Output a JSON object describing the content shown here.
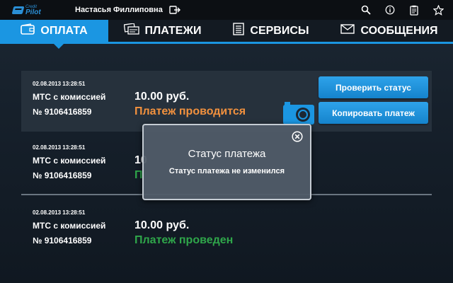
{
  "app": {
    "logo_line1": "Credit",
    "logo_line2": "Pilot",
    "brand_color": "#1b96e2"
  },
  "header": {
    "username": "Настасья Филлиповна",
    "icons": [
      "logout-icon",
      "search-icon",
      "info-icon",
      "clipboard-icon",
      "star-icon"
    ]
  },
  "nav": {
    "tabs": [
      {
        "label": "ОПЛАТА",
        "icon": "wallet-icon",
        "active": true
      },
      {
        "label": "ПЛАТЕЖИ",
        "icon": "payments-icon",
        "active": false
      },
      {
        "label": "СЕРВИСЫ",
        "icon": "list-icon",
        "active": false
      },
      {
        "label": "СООБЩЕНИЯ",
        "icon": "envelope-icon",
        "active": false
      }
    ]
  },
  "payments": [
    {
      "date": "02.08.2013 13:28:51",
      "name": "МТС с комиссией",
      "number": "№ 9106416859",
      "amount": "10.00 руб.",
      "status": "Платеж проводится",
      "status_color": "#f2913e",
      "buttons": [
        "Проверить статус",
        "Копировать платеж"
      ]
    },
    {
      "date": "02.08.2013 13:28:51",
      "name": "МТС с комиссией",
      "number": "№ 9106416859",
      "amount": "10",
      "status": "П",
      "status_color": "#2fa64a"
    },
    {
      "date": "02.08.2013 13:28:51",
      "name": "МТС с комиссией",
      "number": "№ 9106416859",
      "amount": "10.00 руб.",
      "status": "Платеж проведен",
      "status_color": "#2fa64a"
    }
  ],
  "modal": {
    "title": "Статус платежа",
    "message": "Статус платежа не изменился"
  }
}
